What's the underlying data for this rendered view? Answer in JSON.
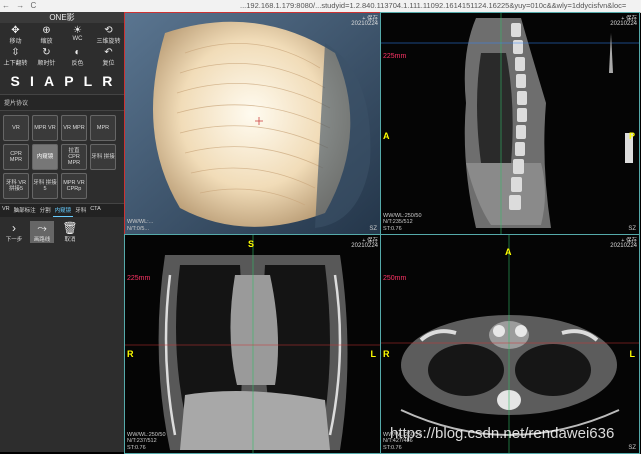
{
  "browser": {
    "nav_glyphs": "← → C",
    "url": "...192.168.1.179:8080/...studyid=1.2.840.113704.1.111.11092.1614151124.16225&yuy=010c&&wly=1ddycisfvn&loc="
  },
  "sidebar": {
    "title": "ONE影",
    "tools": [
      {
        "icon": "✥",
        "label": "移动"
      },
      {
        "icon": "⊕",
        "label": "缩放"
      },
      {
        "icon": "☀",
        "label": "WC"
      },
      {
        "icon": "⟲",
        "label": "三维旋转"
      },
      {
        "icon": "⇳",
        "label": "上下翻转"
      },
      {
        "icon": "↻",
        "label": "顺时针"
      },
      {
        "icon": "◐",
        "label": "反色"
      },
      {
        "icon": "↶",
        "label": "复位"
      }
    ],
    "orientation_letters": [
      "S",
      "I",
      "A",
      "P",
      "L",
      "R"
    ],
    "protocol_label": "提片协议",
    "protocols": [
      {
        "label": "VR",
        "active": false
      },
      {
        "label": "MPR VR",
        "active": false
      },
      {
        "label": "VR MPR",
        "active": false
      },
      {
        "label": "MPR",
        "active": false
      },
      {
        "label": "CPR MPR",
        "active": false
      },
      {
        "label": "内窥镜",
        "active": true
      },
      {
        "label": "拉直 CPR MPR",
        "active": false
      },
      {
        "label": "牙科 拼接",
        "active": false
      },
      {
        "label": "牙科 VR 拼接5",
        "active": false
      },
      {
        "label": "牙科 拼接5",
        "active": false
      },
      {
        "label": "MPR VR CPRp",
        "active": false
      }
    ],
    "tabs": [
      {
        "label": "VR",
        "active": false
      },
      {
        "label": "脑部标注",
        "active": false
      },
      {
        "label": "分割",
        "active": false
      },
      {
        "label": "内窥镜",
        "active": true
      },
      {
        "label": "牙科",
        "active": false
      },
      {
        "label": "CTA",
        "active": false
      }
    ],
    "bottom_tools": [
      {
        "icon": "›",
        "label": "下一步",
        "active": false
      },
      {
        "icon": "⤳",
        "label": "画路线",
        "active": true
      },
      {
        "icon": "🗑",
        "label": "取消",
        "active": false
      }
    ]
  },
  "viewports": {
    "endo": {
      "header": "+ 保存",
      "date": "20210224",
      "info": [
        "WW/WL:...",
        "N/T:0/5..."
      ],
      "sz": "SZ"
    },
    "sagittal": {
      "header": "+ 保存",
      "date": "20210224",
      "scale": "225mm",
      "info": [
        "WW/WL:250/50",
        "N/T:235/512",
        "ST:0.76"
      ],
      "sz": "SZ",
      "top": "",
      "bottom": "",
      "left": "A",
      "right": "P"
    },
    "coronal": {
      "header": "+ 保存",
      "date": "20210224",
      "scale": "225mm",
      "info": [
        "WW/WL:250/50",
        "N/T:237/512",
        "ST:0.76"
      ],
      "sz": "",
      "top": "S",
      "bottom": "",
      "left": "R",
      "right": "L"
    },
    "axial": {
      "header": "+ 保存",
      "date": "20210224",
      "scale": "250mm",
      "info": [
        "WW/WL:250/50",
        "N/T:427/486",
        "ST:0.76"
      ],
      "sz": "SZ",
      "top": "A",
      "bottom": "",
      "left": "R",
      "right": "L"
    }
  },
  "watermark": "https://blog.csdn.net/rendawei636"
}
